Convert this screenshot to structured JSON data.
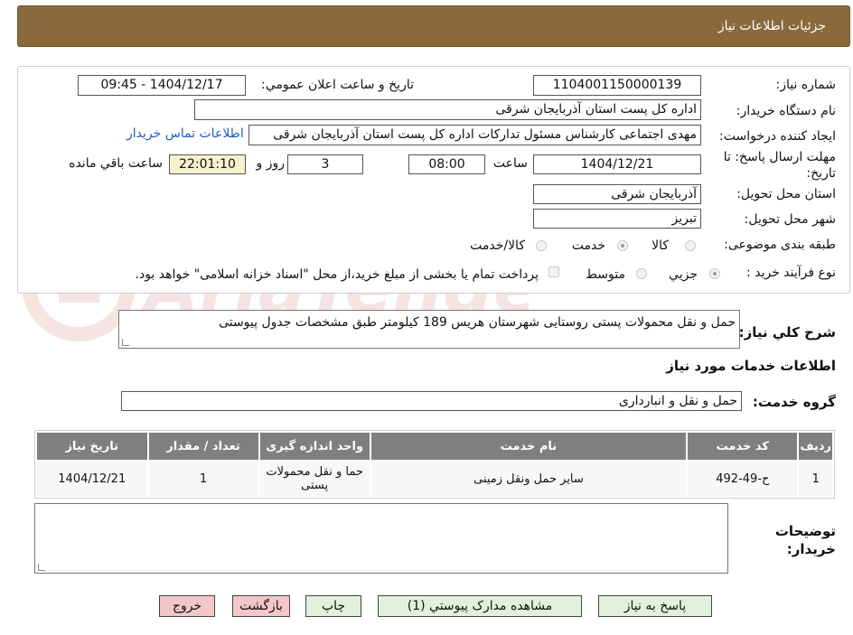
{
  "header": {
    "title": "جزئیات اطلاعات نیاز"
  },
  "watermark": {
    "text": "AriaTender.neT"
  },
  "form": {
    "need_number_label": "شماره نیاز:",
    "need_number": "1104001150000139",
    "announce_label": "تاریخ و ساعت اعلان عمومي:",
    "announce_value": "1404/12/17 - 09:45",
    "buyer_org_label": "نام دستگاه خريدار:",
    "buyer_org": "اداره کل پست استان آذربایجان شرقی",
    "creator_label": "ايجاد كننده درخواست:",
    "creator": "مهدی اجتماعی کارشناس مسئول تدارکات اداره کل پست استان آذربایجان شرقی",
    "contact_link": "اطلاعات تماس خريدار",
    "deadline_label": "مهلت ارسال پاسخ: تا تاريخ:",
    "deadline_date": "1404/12/21",
    "time_label": "ساعت",
    "deadline_time": "08:00",
    "days": "3",
    "days_label": "روز و",
    "remaining": "22:01:10",
    "remaining_label": "ساعت باقي مانده",
    "province_label": "استان محل تحویل:",
    "province": "آذربایجان شرقی",
    "city_label": "شهر محل تحویل:",
    "city": "تبریز",
    "category_label": "طبقه بندی موضوعی:",
    "category_options": [
      "كالا",
      "خدمت",
      "كالا/خدمت"
    ],
    "process_label": "نوع فرآيند خريد :",
    "process_options": [
      "جزيي",
      "متوسط"
    ],
    "payment_note": "پرداخت تمام یا بخشی از مبلغ خرید،از محل \"اسناد خزانه اسلامی\" خواهد بود.",
    "description_label": "شرح كلي نياز:",
    "description": "حمل و نقل محمولات پستی روستایی شهرستان هریس  189 کیلومتر طبق مشخصات جدول پیوستی",
    "services_title": "اطلاعات خدمات مورد نياز",
    "service_group_label": "گروه خدمت:",
    "service_group": "حمل و نقل و انبارداری",
    "buyer_notes_label": "توضیحات خریدار:"
  },
  "table": {
    "headers": [
      "رديف",
      "كد خدمت",
      "نام خدمت",
      "واحد اندازه گيری",
      "تعداد / مقدار",
      "تاريخ نياز"
    ],
    "rows": [
      [
        "1",
        "ح-49-492",
        "سایر حمل ونقل زمینی",
        "حما و نقل محمولات پستی",
        "1",
        "1404/12/21"
      ]
    ]
  },
  "buttons": {
    "reply": "پاسخ به نیاز",
    "attachments": "مشاهده مدارک پیوستي (1)",
    "print": "چاپ",
    "back": "بازگشت",
    "exit": "خروج"
  }
}
